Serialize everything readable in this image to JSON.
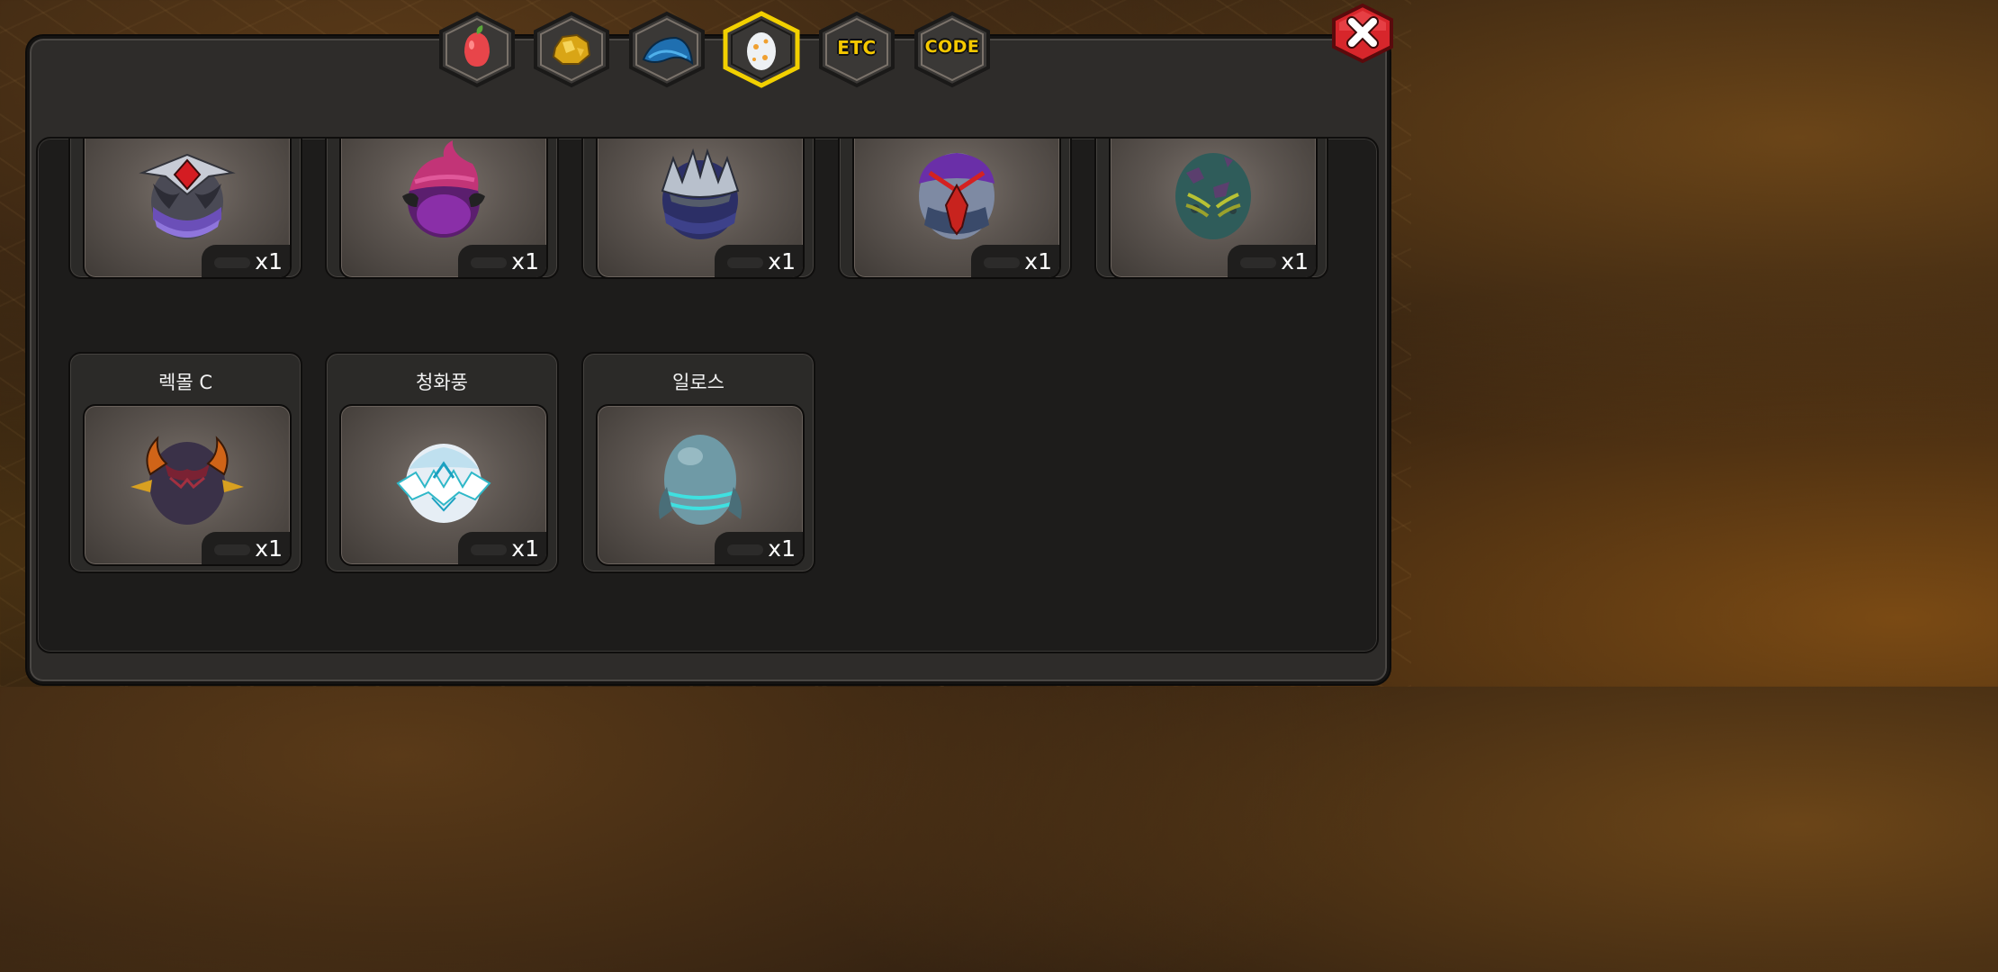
{
  "tabs": [
    {
      "id": "fruit",
      "icon": "fruit-icon",
      "label": "",
      "active": false
    },
    {
      "id": "gold",
      "icon": "gold-nugget-icon",
      "label": "",
      "active": false
    },
    {
      "id": "feather",
      "icon": "blue-feather-icon",
      "label": "",
      "active": false
    },
    {
      "id": "egg",
      "icon": "egg-icon",
      "label": "",
      "active": true
    },
    {
      "id": "etc",
      "icon": "etc-text-icon",
      "label": "ETC",
      "active": false
    },
    {
      "id": "code",
      "icon": "code-text-icon",
      "label": "CODE",
      "active": false
    }
  ],
  "colors": {
    "active_tab_border": "#f2d000",
    "quantity_text": "#ffffff",
    "close_button": "#d7262b"
  },
  "items": [
    {
      "name": "",
      "qty": "x1",
      "icon": "silver-red-gem-egg-icon"
    },
    {
      "name": "",
      "qty": "x1",
      "icon": "pink-swirl-purple-egg-icon"
    },
    {
      "name": "",
      "qty": "x1",
      "icon": "silver-spiked-navy-egg-icon"
    },
    {
      "name": "",
      "qty": "x1",
      "icon": "purple-red-blade-egg-icon"
    },
    {
      "name": "",
      "qty": "x1",
      "icon": "teal-spotted-egg-icon"
    },
    {
      "name": "렉몰 C",
      "qty": "x1",
      "icon": "dark-horned-egg-icon"
    },
    {
      "name": "청화풍",
      "qty": "x1",
      "icon": "white-ice-egg-icon"
    },
    {
      "name": "일로스",
      "qty": "x1",
      "icon": "cyan-striped-egg-icon"
    }
  ]
}
